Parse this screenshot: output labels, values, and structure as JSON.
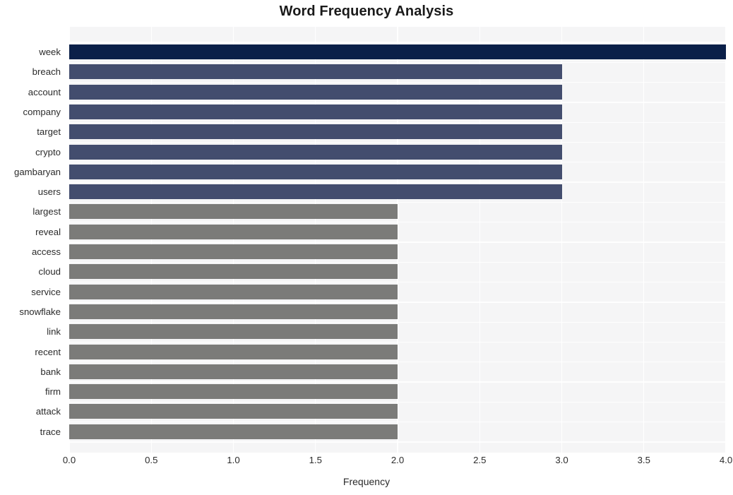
{
  "chart_data": {
    "type": "bar",
    "orientation": "horizontal",
    "title": "Word Frequency Analysis",
    "xlabel": "Frequency",
    "ylabel": "",
    "categories": [
      "week",
      "breach",
      "account",
      "company",
      "target",
      "crypto",
      "gambaryan",
      "users",
      "largest",
      "reveal",
      "access",
      "cloud",
      "service",
      "snowflake",
      "link",
      "recent",
      "bank",
      "firm",
      "attack",
      "trace"
    ],
    "values": [
      4,
      3,
      3,
      3,
      3,
      3,
      3,
      3,
      2,
      2,
      2,
      2,
      2,
      2,
      2,
      2,
      2,
      2,
      2,
      2
    ],
    "bar_colors": [
      "#0b2049",
      "#434d6e",
      "#434d6e",
      "#434d6e",
      "#434d6e",
      "#434d6e",
      "#434d6e",
      "#434d6e",
      "#7b7b79",
      "#7b7b79",
      "#7b7b79",
      "#7b7b79",
      "#7b7b79",
      "#7b7b79",
      "#7b7b79",
      "#7b7b79",
      "#7b7b79",
      "#7b7b79",
      "#7b7b79",
      "#7b7b79"
    ],
    "xlim": [
      0.0,
      4.0
    ],
    "xticks": [
      0.0,
      0.5,
      1.0,
      1.5,
      2.0,
      2.5,
      3.0,
      3.5,
      4.0
    ],
    "xticklabels": [
      "0.0",
      "0.5",
      "1.0",
      "1.5",
      "2.0",
      "2.5",
      "3.0",
      "3.5",
      "4.0"
    ],
    "grid": true,
    "grid_color": "#ffffff",
    "plot_background": "#f5f5f6",
    "figure_background": "#ffffff",
    "legend": null,
    "legend_position": "none"
  },
  "colors": {
    "accent_dark": "#0b2049",
    "accent_mid": "#434d6e",
    "accent_light": "#7b7b79",
    "text": "#2b2b2b",
    "title": "#1a1a1a",
    "plot_bg": "#f5f5f6",
    "grid": "#ffffff",
    "fig_bg": "#ffffff"
  }
}
